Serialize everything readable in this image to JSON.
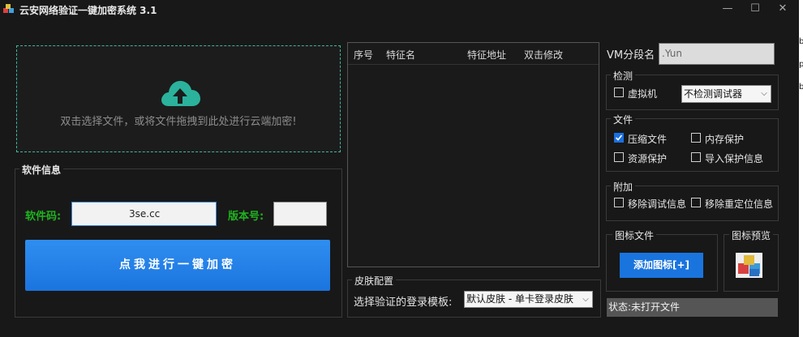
{
  "window": {
    "title": "云安网络验证一键加密系统 3.1",
    "min": "—",
    "max": "☐",
    "close": "✕"
  },
  "drop_zone": {
    "text": "双击选择文件，或将文件拖拽到此处进行云端加密!"
  },
  "software_info": {
    "title": "软件信息",
    "code_label": "软件码:",
    "code_value": "3se.cc",
    "version_label": "版本号:",
    "version_value": "",
    "encrypt_button": "点我进行一键加密"
  },
  "feature_list": {
    "columns": [
      "序号",
      "特征名",
      "特征地址",
      "双击修改"
    ]
  },
  "skin": {
    "title": "皮肤配置",
    "label": "选择验证的登录模板:",
    "selected": "默认皮肤 - 单卡登录皮肤"
  },
  "vm": {
    "label": "VM分段名",
    "value": ".Yun"
  },
  "detect": {
    "title": "检测",
    "vm_label": "虚拟机",
    "debugger_selected": "不检测调试器"
  },
  "file_opts": {
    "title": "文件",
    "compress": "压缩文件",
    "memory": "内存保护",
    "resource": "资源保护",
    "import": "导入保护信息"
  },
  "extra": {
    "title": "附加",
    "remove_debug": "移除调试信息",
    "remove_reloc": "移除重定位信息"
  },
  "icon_file": {
    "title": "图标文件",
    "add_button": "添加图标[+]"
  },
  "icon_preview": {
    "title": "图标预览"
  },
  "status": {
    "text": "状态:未打开文件"
  },
  "edge_text": {
    "a": "b",
    "b": "p",
    "c": "b"
  },
  "colors": {
    "accent_green": "#3fb6a0",
    "button_blue": "#1a74de",
    "label_green": "#1fb31f"
  }
}
